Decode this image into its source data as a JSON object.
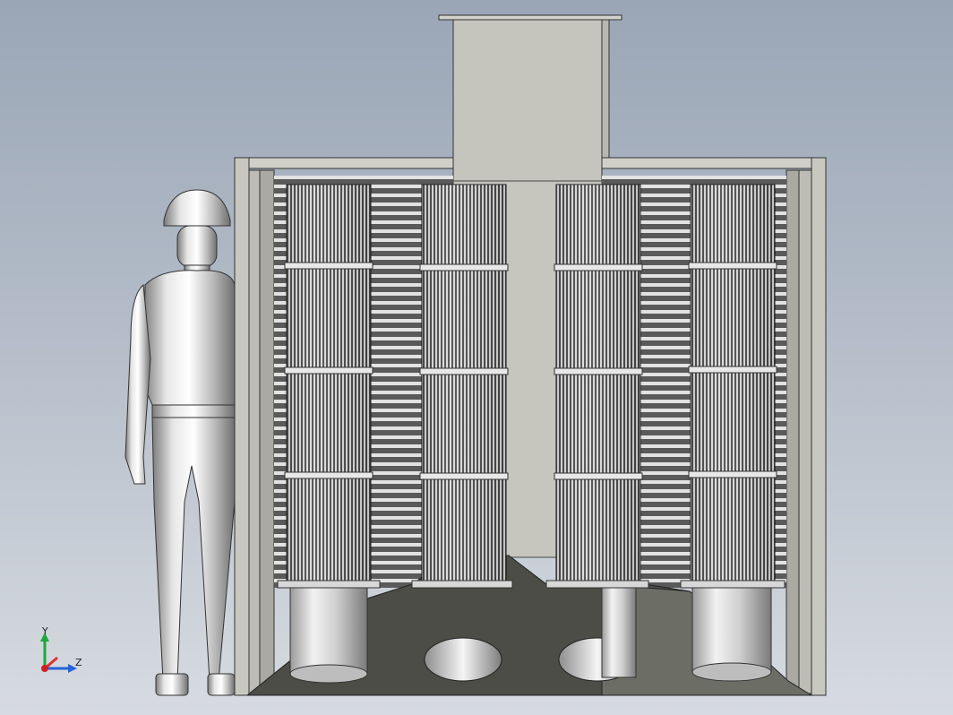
{
  "scene": {
    "model_type": "cartridge dust collector with human scale reference",
    "filter_count": 4,
    "colors": {
      "background_top": "#9aa6b6",
      "background_bottom": "#d7dbe1",
      "housing": "#c4c4bc",
      "filter_dark": "#2e2e2e",
      "filter_light": "#b9b9b9",
      "hopper": "#4b4d46",
      "figure_metal": "#d0d0d0"
    }
  },
  "triad": {
    "y_label": "Y",
    "z_label": "Z",
    "icon": "coordinate-axis-triad-icon"
  }
}
